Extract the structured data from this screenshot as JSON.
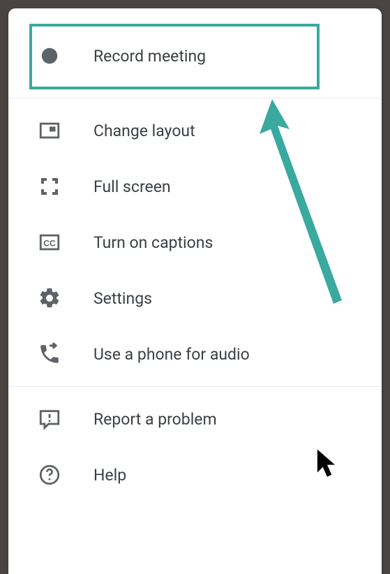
{
  "colors": {
    "accent": "#3aa9a0",
    "icon": "#5f6368",
    "text": "#3c4043"
  },
  "menu": {
    "record": {
      "label": "Record meeting"
    },
    "change_layout": {
      "label": "Change layout"
    },
    "full_screen": {
      "label": "Full screen"
    },
    "captions": {
      "label": "Turn on captions"
    },
    "settings": {
      "label": "Settings"
    },
    "phone_audio": {
      "label": "Use a phone for audio"
    },
    "report": {
      "label": "Report a problem"
    },
    "help": {
      "label": "Help"
    }
  }
}
